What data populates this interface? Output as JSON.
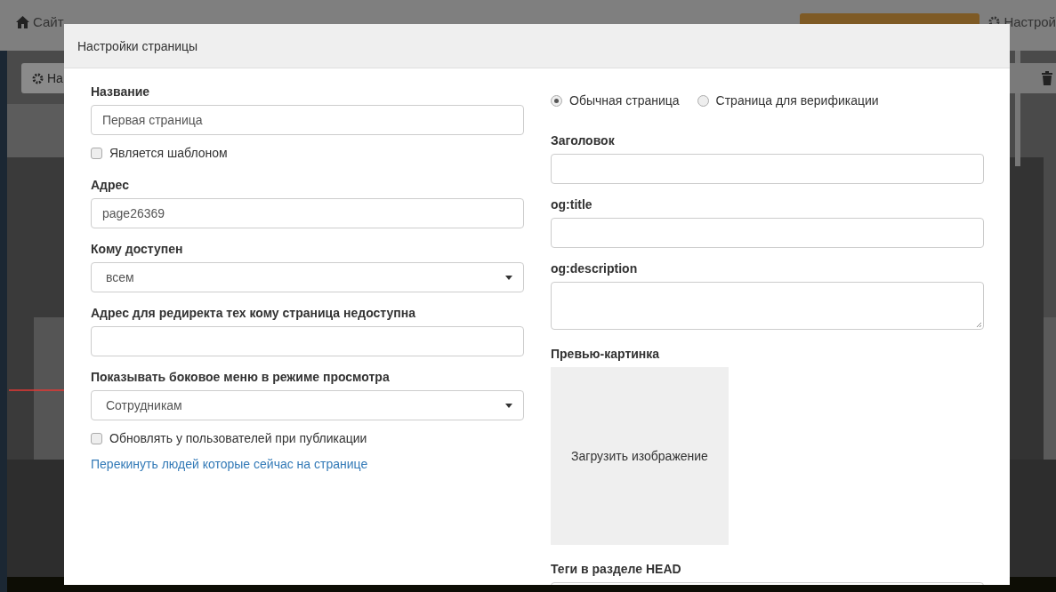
{
  "page": {
    "breadcrumbs": [
      {
        "label": "Сайт",
        "kind": "home"
      }
    ],
    "settings_link": "Настрой",
    "toolbar_button": "На"
  },
  "dialog": {
    "title": "Настройки страницы",
    "left_fields": [
      {
        "kind": "text",
        "label": "Название",
        "value": "Первая страница"
      },
      {
        "kind": "checkbox",
        "label": "Является шаблоном",
        "checked": false
      },
      {
        "kind": "text",
        "label": "Адрес",
        "value": "page26369"
      },
      {
        "kind": "select",
        "label": "Кому доступен",
        "value": "всем"
      },
      {
        "kind": "text",
        "label": "Адрес для редиректа тех кому страница недоступна"
      },
      {
        "kind": "select",
        "label": "Показывать боковое меню в режиме просмотра",
        "value": "Сотрудникам"
      },
      {
        "kind": "checkbox",
        "label": "Обновлять у пользователей при публикации",
        "checked": false
      },
      {
        "kind": "link",
        "label": "Перекинуть людей которые сейчас на странице"
      }
    ],
    "page_type": [
      {
        "label": "Обычная страница",
        "selected": true
      },
      {
        "label": "Страница для верификации",
        "selected": false
      }
    ],
    "right_fields": [
      {
        "kind": "text",
        "label": "Заголовок"
      },
      {
        "kind": "text",
        "label": "og:title"
      },
      {
        "kind": "textarea",
        "label": "og:description"
      },
      {
        "label": "Превью-картинка",
        "button": "Загрузить изображение"
      },
      {
        "kind": "text",
        "label": "Теги в разделе HEAD"
      }
    ]
  }
}
